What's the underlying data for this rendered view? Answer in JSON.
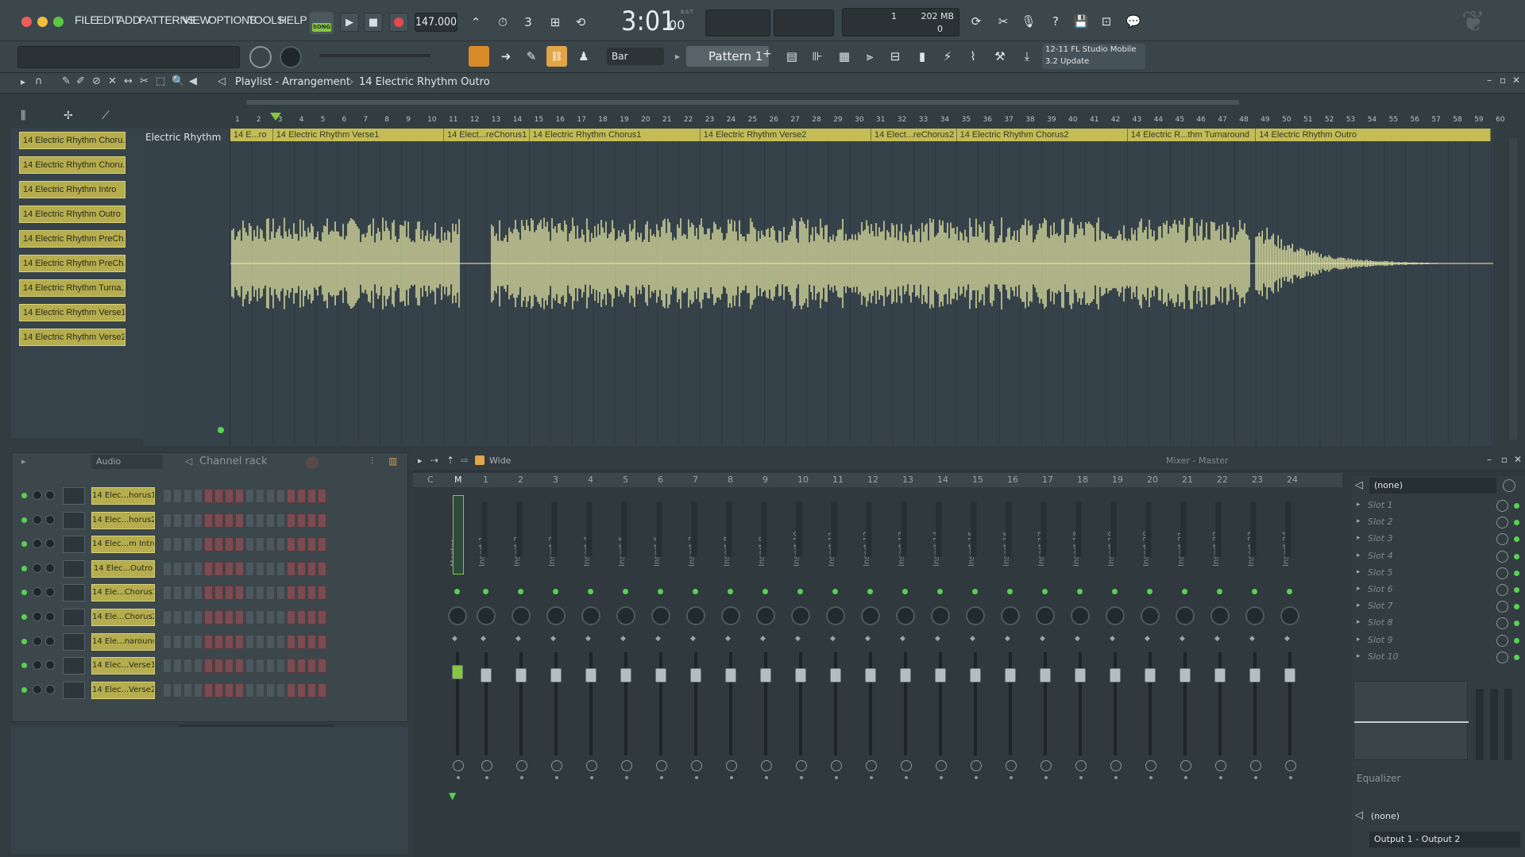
{
  "menu": [
    "FILE",
    "EDIT",
    "ADD",
    "PATTERNS",
    "VIEW",
    "OPTIONS",
    "TOOLS",
    "HELP"
  ],
  "transport": {
    "mode": "SONG",
    "tempo": "147.000",
    "time": "3:01",
    "time_sub": "00",
    "time_unit": "B:S:T",
    "mem_line1": "1",
    "mem_size": "202 MB",
    "mem_line2": "0"
  },
  "toolbar2": {
    "snap": "Bar",
    "pattern": "Pattern 1",
    "news_line1": "12-11  FL Studio Mobile",
    "news_line2": "3.2 Update"
  },
  "playlist": {
    "title": "Playlist - Arrangement",
    "crumb": "14 Electric Rhythm Outro",
    "track_name": "Electric Rhythm",
    "picker_clips": [
      "14 Electric Rhythm Choru...",
      "14 Electric Rhythm Choru...",
      "14 Electric Rhythm Intro",
      "14 Electric Rhythm Outro",
      "14 Electric Rhythm PreCh...",
      "14 Electric Rhythm PreCh...",
      "14 Electric Rhythm Turna...",
      "14 Electric Rhythm Verse1",
      "14 Electric Rhythm Verse2"
    ],
    "ruler": [
      "1",
      "2",
      "3",
      "4",
      "5",
      "6",
      "7",
      "8",
      "9",
      "10",
      "11",
      "12",
      "13",
      "14",
      "15",
      "16",
      "17",
      "18",
      "19",
      "20",
      "21",
      "22",
      "23",
      "24",
      "25",
      "26",
      "27",
      "28",
      "29",
      "30",
      "31",
      "32",
      "33",
      "34",
      "35",
      "36",
      "37",
      "38",
      "39",
      "40",
      "41",
      "42",
      "43",
      "44",
      "45",
      "46",
      "47",
      "48",
      "49",
      "50",
      "51",
      "52",
      "53",
      "54",
      "55",
      "56",
      "57",
      "58",
      "59",
      "60"
    ],
    "clips": [
      {
        "label": "14 E...ro",
        "bars": 2
      },
      {
        "label": "14 Electric Rhythm Verse1",
        "bars": 8
      },
      {
        "label": "14 Elect...reChorus1",
        "bars": 4
      },
      {
        "label": "14 Electric Rhythm Chorus1",
        "bars": 8
      },
      {
        "label": "14 Electric Rhythm Verse2",
        "bars": 8
      },
      {
        "label": "14 Elect...reChorus2",
        "bars": 4
      },
      {
        "label": "14 Electric Rhythm Chorus2",
        "bars": 8
      },
      {
        "label": "14 Electric R...thm Turnaround",
        "bars": 6
      },
      {
        "label": "14 Electric Rhythm Outro",
        "bars": 11
      }
    ]
  },
  "rack": {
    "filter": "Audio",
    "title": "Channel rack",
    "channels": [
      "14 Elec...horus1",
      "14 Elec...horus2",
      "14 Elec...m Intro",
      "14 Elec...Outro",
      "14 Ele...Chorus1",
      "14 Ele...Chorus2",
      "14 Ele...naround",
      "14 Elec...Verse1",
      "14 Elec...Verse2"
    ],
    "add": "+"
  },
  "mixer": {
    "view": "Wide",
    "title": "Mixer - Master",
    "header": [
      "C",
      "M",
      "1",
      "2",
      "3",
      "4",
      "5",
      "6",
      "7",
      "8",
      "9",
      "10",
      "11",
      "12",
      "13",
      "14",
      "15",
      "16",
      "17",
      "18",
      "19",
      "20",
      "21",
      "22",
      "23",
      "24"
    ],
    "strips": [
      "Master",
      "Insert 1",
      "Insert 2",
      "Insert 3",
      "Insert 4",
      "Insert 5",
      "Insert 6",
      "Insert 7",
      "Insert 8",
      "Insert 9",
      "Insert 10",
      "Insert 11",
      "Insert 12",
      "Insert 13",
      "Insert 14",
      "Insert 15",
      "Insert 16",
      "Insert 17",
      "Insert 18",
      "Insert 19",
      "Insert 20",
      "Insert 21",
      "Insert 22",
      "Insert 23",
      "Insert 24"
    ],
    "input": "(none)",
    "slots": [
      "Slot 1",
      "Slot 2",
      "Slot 3",
      "Slot 4",
      "Slot 5",
      "Slot 6",
      "Slot 7",
      "Slot 8",
      "Slot 9",
      "Slot 10"
    ],
    "eq_label": "Equalizer",
    "output_none": "(none)",
    "output": "Output 1 - Output 2"
  },
  "colors": {
    "clip": "#c4bc57",
    "waveform": "#eef0a8",
    "led": "#59d152",
    "record": "#e14b4b"
  }
}
